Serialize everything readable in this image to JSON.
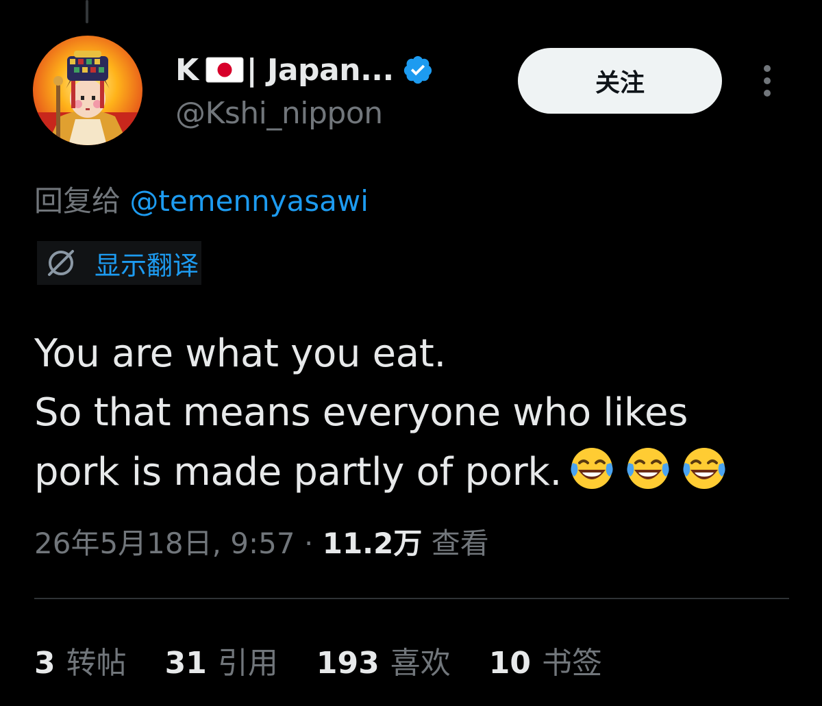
{
  "author": {
    "name_prefix": "K",
    "flag_icon": "japan-flag-icon",
    "name_suffix": "| Japan...",
    "verified_icon": "verified-badge-icon",
    "handle": "@Kshi_nippon",
    "avatar_icon": "avatar-image"
  },
  "follow_button": {
    "label": "关注"
  },
  "more_icon": "more-vertical-icon",
  "reply": {
    "prefix": "回复给",
    "handle": "@temennyasawi"
  },
  "translate": {
    "icon": "translate-icon",
    "label": "显示翻译"
  },
  "tweet": {
    "line1": "You are what you eat.",
    "line2": "So that means everyone who likes",
    "line3": "pork is made partly of pork.",
    "emoji_icon": "tears-of-joy-emoji",
    "emoji_count": 3
  },
  "meta": {
    "timestamp": "26年5月18日, 9:57",
    "separator": "·",
    "views_count": "11.2万",
    "views_label": "查看"
  },
  "stats": {
    "reposts": {
      "count": "3",
      "label": "转帖"
    },
    "quotes": {
      "count": "31",
      "label": "引用"
    },
    "likes": {
      "count": "193",
      "label": "喜欢"
    },
    "bookmarks": {
      "count": "10",
      "label": "书签"
    }
  },
  "colors": {
    "background": "#000000",
    "primary_text": "#e7e9ea",
    "secondary_text": "#71767b",
    "link_blue": "#1d9bf0",
    "divider": "#2f3336",
    "follow_button_bg": "#eff3f4"
  }
}
